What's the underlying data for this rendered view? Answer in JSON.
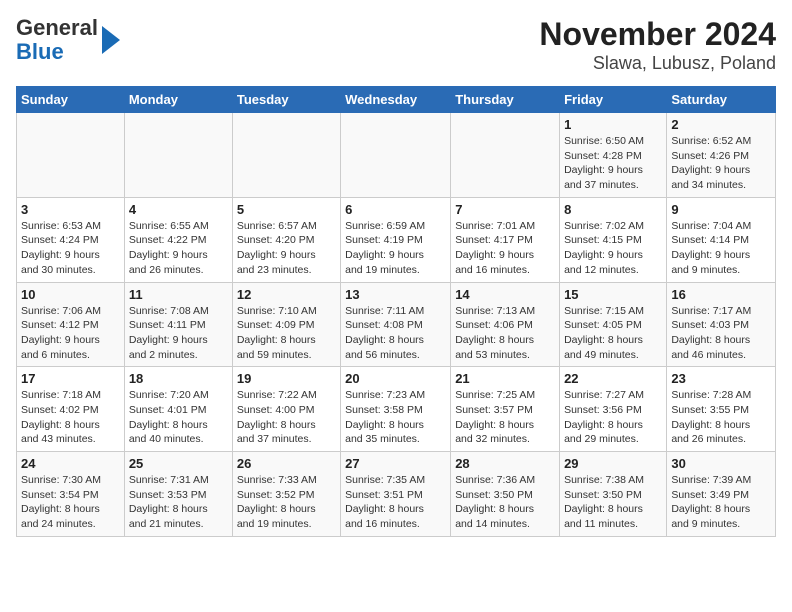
{
  "header": {
    "logo_line1": "General",
    "logo_line2": "Blue",
    "title": "November 2024",
    "subtitle": "Slawa, Lubusz, Poland"
  },
  "columns": [
    "Sunday",
    "Monday",
    "Tuesday",
    "Wednesday",
    "Thursday",
    "Friday",
    "Saturday"
  ],
  "weeks": [
    [
      {
        "day": "",
        "info": ""
      },
      {
        "day": "",
        "info": ""
      },
      {
        "day": "",
        "info": ""
      },
      {
        "day": "",
        "info": ""
      },
      {
        "day": "",
        "info": ""
      },
      {
        "day": "1",
        "info": "Sunrise: 6:50 AM\nSunset: 4:28 PM\nDaylight: 9 hours\nand 37 minutes."
      },
      {
        "day": "2",
        "info": "Sunrise: 6:52 AM\nSunset: 4:26 PM\nDaylight: 9 hours\nand 34 minutes."
      }
    ],
    [
      {
        "day": "3",
        "info": "Sunrise: 6:53 AM\nSunset: 4:24 PM\nDaylight: 9 hours\nand 30 minutes."
      },
      {
        "day": "4",
        "info": "Sunrise: 6:55 AM\nSunset: 4:22 PM\nDaylight: 9 hours\nand 26 minutes."
      },
      {
        "day": "5",
        "info": "Sunrise: 6:57 AM\nSunset: 4:20 PM\nDaylight: 9 hours\nand 23 minutes."
      },
      {
        "day": "6",
        "info": "Sunrise: 6:59 AM\nSunset: 4:19 PM\nDaylight: 9 hours\nand 19 minutes."
      },
      {
        "day": "7",
        "info": "Sunrise: 7:01 AM\nSunset: 4:17 PM\nDaylight: 9 hours\nand 16 minutes."
      },
      {
        "day": "8",
        "info": "Sunrise: 7:02 AM\nSunset: 4:15 PM\nDaylight: 9 hours\nand 12 minutes."
      },
      {
        "day": "9",
        "info": "Sunrise: 7:04 AM\nSunset: 4:14 PM\nDaylight: 9 hours\nand 9 minutes."
      }
    ],
    [
      {
        "day": "10",
        "info": "Sunrise: 7:06 AM\nSunset: 4:12 PM\nDaylight: 9 hours\nand 6 minutes."
      },
      {
        "day": "11",
        "info": "Sunrise: 7:08 AM\nSunset: 4:11 PM\nDaylight: 9 hours\nand 2 minutes."
      },
      {
        "day": "12",
        "info": "Sunrise: 7:10 AM\nSunset: 4:09 PM\nDaylight: 8 hours\nand 59 minutes."
      },
      {
        "day": "13",
        "info": "Sunrise: 7:11 AM\nSunset: 4:08 PM\nDaylight: 8 hours\nand 56 minutes."
      },
      {
        "day": "14",
        "info": "Sunrise: 7:13 AM\nSunset: 4:06 PM\nDaylight: 8 hours\nand 53 minutes."
      },
      {
        "day": "15",
        "info": "Sunrise: 7:15 AM\nSunset: 4:05 PM\nDaylight: 8 hours\nand 49 minutes."
      },
      {
        "day": "16",
        "info": "Sunrise: 7:17 AM\nSunset: 4:03 PM\nDaylight: 8 hours\nand 46 minutes."
      }
    ],
    [
      {
        "day": "17",
        "info": "Sunrise: 7:18 AM\nSunset: 4:02 PM\nDaylight: 8 hours\nand 43 minutes."
      },
      {
        "day": "18",
        "info": "Sunrise: 7:20 AM\nSunset: 4:01 PM\nDaylight: 8 hours\nand 40 minutes."
      },
      {
        "day": "19",
        "info": "Sunrise: 7:22 AM\nSunset: 4:00 PM\nDaylight: 8 hours\nand 37 minutes."
      },
      {
        "day": "20",
        "info": "Sunrise: 7:23 AM\nSunset: 3:58 PM\nDaylight: 8 hours\nand 35 minutes."
      },
      {
        "day": "21",
        "info": "Sunrise: 7:25 AM\nSunset: 3:57 PM\nDaylight: 8 hours\nand 32 minutes."
      },
      {
        "day": "22",
        "info": "Sunrise: 7:27 AM\nSunset: 3:56 PM\nDaylight: 8 hours\nand 29 minutes."
      },
      {
        "day": "23",
        "info": "Sunrise: 7:28 AM\nSunset: 3:55 PM\nDaylight: 8 hours\nand 26 minutes."
      }
    ],
    [
      {
        "day": "24",
        "info": "Sunrise: 7:30 AM\nSunset: 3:54 PM\nDaylight: 8 hours\nand 24 minutes."
      },
      {
        "day": "25",
        "info": "Sunrise: 7:31 AM\nSunset: 3:53 PM\nDaylight: 8 hours\nand 21 minutes."
      },
      {
        "day": "26",
        "info": "Sunrise: 7:33 AM\nSunset: 3:52 PM\nDaylight: 8 hours\nand 19 minutes."
      },
      {
        "day": "27",
        "info": "Sunrise: 7:35 AM\nSunset: 3:51 PM\nDaylight: 8 hours\nand 16 minutes."
      },
      {
        "day": "28",
        "info": "Sunrise: 7:36 AM\nSunset: 3:50 PM\nDaylight: 8 hours\nand 14 minutes."
      },
      {
        "day": "29",
        "info": "Sunrise: 7:38 AM\nSunset: 3:50 PM\nDaylight: 8 hours\nand 11 minutes."
      },
      {
        "day": "30",
        "info": "Sunrise: 7:39 AM\nSunset: 3:49 PM\nDaylight: 8 hours\nand 9 minutes."
      }
    ]
  ]
}
